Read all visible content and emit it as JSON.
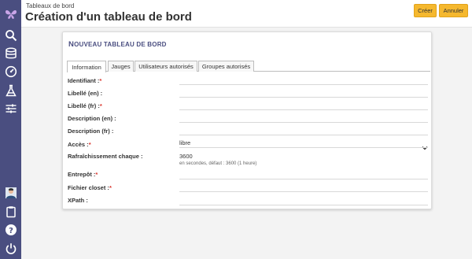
{
  "header": {
    "breadcrumb": "Tableaux de bord",
    "title": "Création d'un tableau de bord",
    "create_label": "Créer",
    "cancel_label": "Annuler"
  },
  "card": {
    "title_first": "N",
    "title_rest": "OUVEAU TABLEAU DE BORD"
  },
  "tabs": [
    {
      "label": "Information"
    },
    {
      "label": "Jauges"
    },
    {
      "label": "Utilisateurs autorisés"
    },
    {
      "label": "Groupes autorisés"
    }
  ],
  "fields": {
    "identifiant": {
      "label": "Identifiant :",
      "required": "*"
    },
    "libelle_en": {
      "label": "Libellé (en) :"
    },
    "libelle_fr": {
      "label": "Libellé (fr) :",
      "required": "*"
    },
    "description_en": {
      "label": "Description (en) :"
    },
    "description_fr": {
      "label": "Description (fr) :"
    },
    "acces": {
      "label": "Accès :",
      "required": "*",
      "value": "libre"
    },
    "rafraichissement": {
      "label": "Rafraîchissement chaque :",
      "value": "3600",
      "hint": "en secondes, défaut : 3600 (1 heure)"
    },
    "entrepot": {
      "label": "Entrepôt :",
      "required": "*"
    },
    "fichier_closet": {
      "label": "Fichier closet :",
      "required": "*"
    },
    "xpath": {
      "label": "XPath :"
    }
  },
  "sidebar": {
    "icons": [
      "logo-butterfly-icon",
      "search-icon",
      "database-icon",
      "gauge-icon",
      "flask-icon",
      "sliders-icon",
      "avatar",
      "clipboard-icon",
      "help-icon",
      "power-icon"
    ]
  },
  "colors": {
    "sidebar": "#4a4e80",
    "accent_button": "#f5b82e",
    "required": "#d9342b"
  }
}
